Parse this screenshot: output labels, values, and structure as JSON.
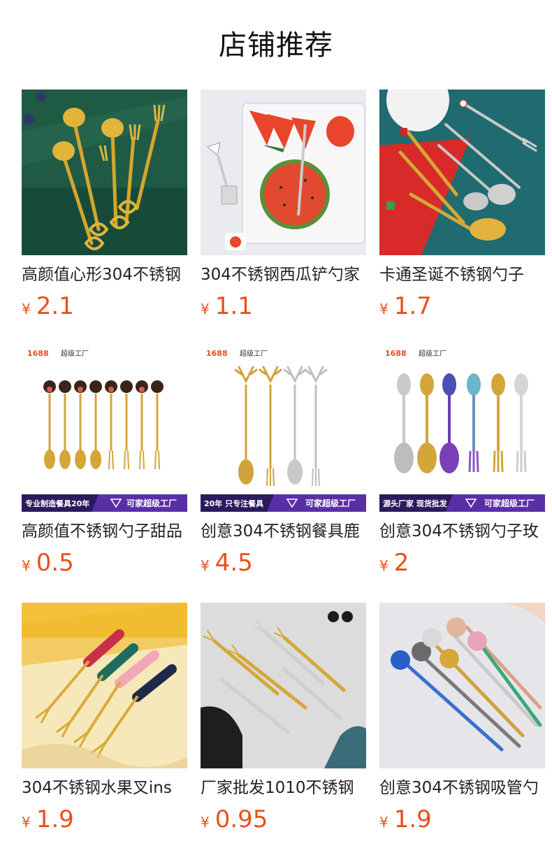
{
  "header": {
    "title": "店铺推荐"
  },
  "currency_symbol": "¥",
  "products": [
    {
      "name": "高颜值心形304不锈钢",
      "price": "2.1",
      "image": "gold-heart-spoons-forks-on-green"
    },
    {
      "name": "304不锈钢西瓜铲勺家",
      "price": "1.1",
      "image": "shovel-spoons-with-watermelon"
    },
    {
      "name": "卡通圣诞不锈钢勺子",
      "price": "1.7",
      "image": "christmas-spoons-forks-on-red-and-teal"
    },
    {
      "name": "高颜值不锈钢勺子甜品",
      "price": "0.5",
      "image": "cartoon-mouse-spoons-forks",
      "banner": {
        "logo": "1688",
        "tag": "超级工厂",
        "left": "专业制造餐具20年",
        "right": "可家超级工厂"
      }
    },
    {
      "name": "创意304不锈钢餐具鹿",
      "price": "4.5",
      "image": "deer-head-spoons-forks",
      "banner": {
        "logo": "1688",
        "tag": "超级工厂",
        "left": "20年 只专注餐具",
        "right": "可家超级工厂"
      }
    },
    {
      "name": "创意304不锈钢勺子玫",
      "price": "2",
      "image": "rose-handle-spoons-forks",
      "banner": {
        "logo": "1688",
        "tag": "超级工厂",
        "left": "源头厂家 现货批发",
        "right": "可家超级工厂"
      }
    },
    {
      "name": "304不锈钢水果叉ins",
      "price": "1.9",
      "image": "colored-handle-fruit-forks"
    },
    {
      "name": "厂家批发1010不锈钢",
      "price": "0.95",
      "image": "gold-silver-fruit-forks"
    },
    {
      "name": "创意304不锈钢吸管勺",
      "price": "1.9",
      "image": "flower-straw-spoons"
    }
  ]
}
